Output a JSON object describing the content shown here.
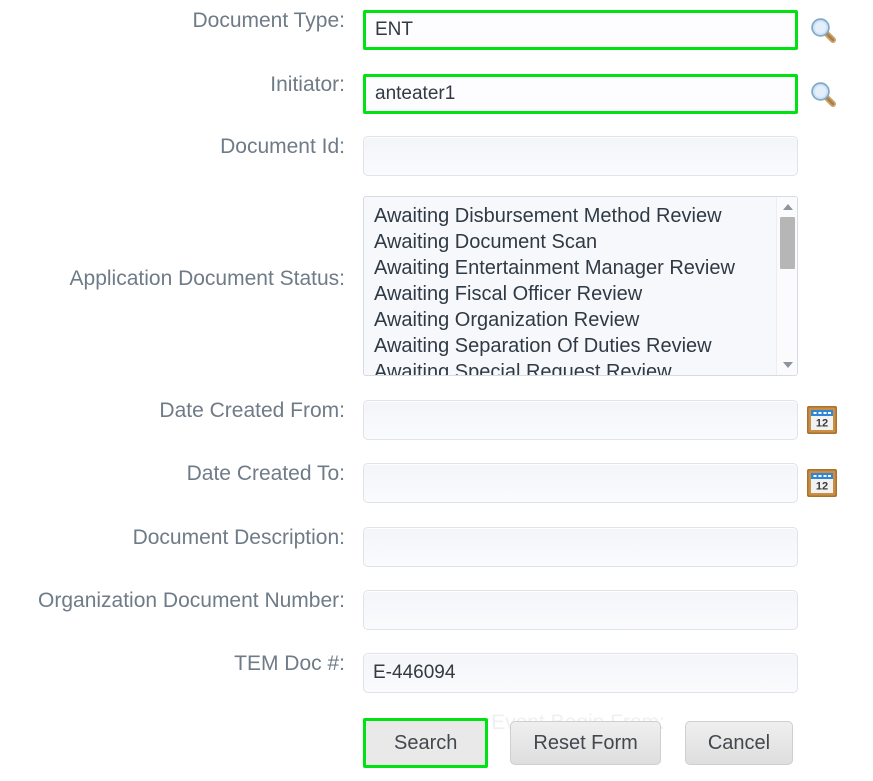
{
  "form": {
    "rows": [
      {
        "label": "Document Type:",
        "value": "ENT",
        "placeholder": "",
        "control": "text",
        "highlight": true,
        "icon": "lookup-icon"
      },
      {
        "label": "Initiator:",
        "value": "anteater1",
        "placeholder": "",
        "control": "text",
        "highlight": true,
        "icon": "lookup-icon"
      },
      {
        "label": "Document Id:",
        "value": "",
        "placeholder": "",
        "control": "text",
        "highlight": false,
        "icon": ""
      },
      {
        "label": "Application Document Status:",
        "value": "",
        "placeholder": "",
        "control": "listbox",
        "highlight": false,
        "icon": ""
      },
      {
        "label": "Date Created From:",
        "value": "",
        "placeholder": "",
        "control": "text",
        "highlight": false,
        "icon": "calendar-icon"
      },
      {
        "label": "Date Created To:",
        "value": "",
        "placeholder": "",
        "control": "text",
        "highlight": false,
        "icon": "calendar-icon"
      },
      {
        "label": "Document Description:",
        "value": "",
        "placeholder": "",
        "control": "text",
        "highlight": false,
        "icon": ""
      },
      {
        "label": "Organization Document Number:",
        "value": "",
        "placeholder": "",
        "control": "text",
        "highlight": false,
        "icon": ""
      },
      {
        "label": "TEM Doc #:",
        "value": "E-446094",
        "placeholder": "",
        "control": "text",
        "highlight": false,
        "icon": ""
      }
    ],
    "application_document_status": {
      "options": [
        "Awaiting Disbursement Method Review",
        "Awaiting Document Scan",
        "Awaiting Entertainment Manager Review",
        "Awaiting Fiscal Officer Review",
        "Awaiting Organization Review",
        "Awaiting Separation Of Duties Review",
        "Awaiting Special Request Review"
      ],
      "selected": ""
    },
    "ghost_label": "Event Begin From:",
    "buttons": {
      "search": "Search",
      "reset": "Reset Form",
      "cancel": "Cancel"
    }
  },
  "colors": {
    "highlight_green": "#00e312",
    "label_gray": "#6f7b87",
    "field_bg": "#f7f8fb",
    "button_bg": "#e6e6e6"
  }
}
